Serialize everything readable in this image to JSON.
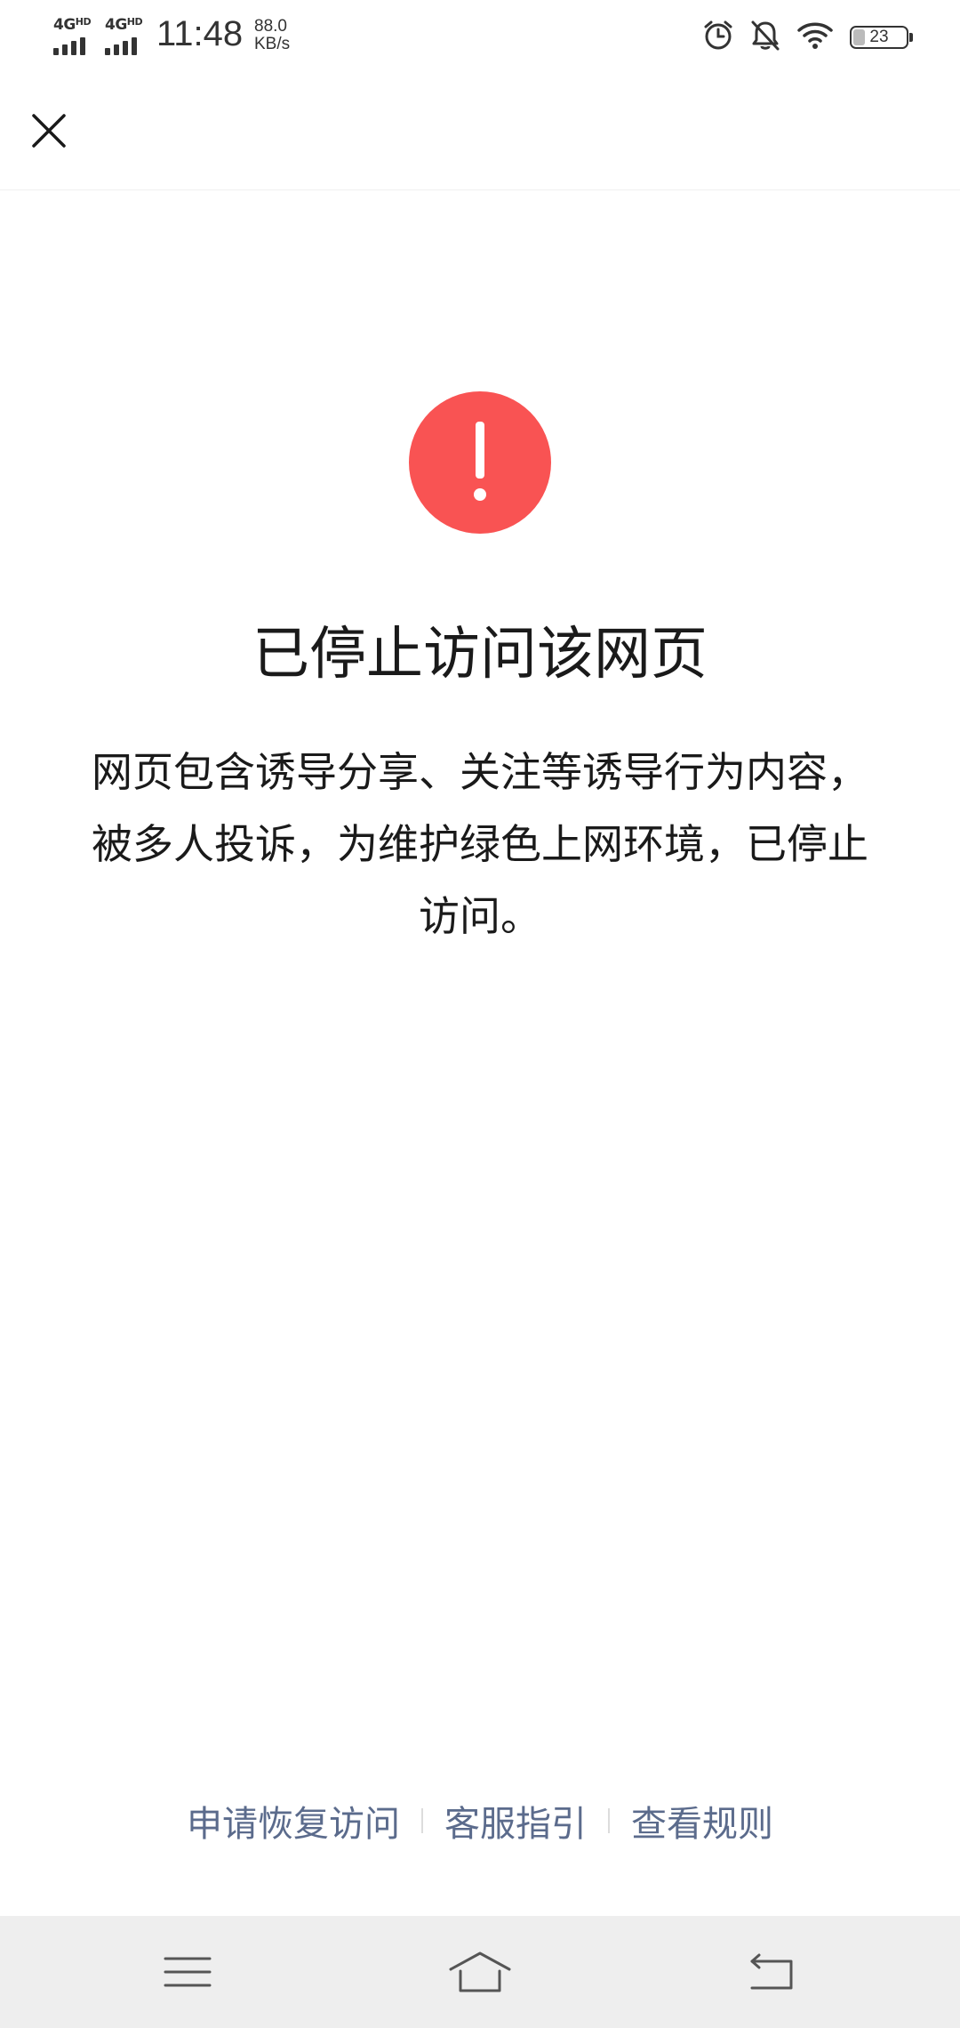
{
  "status_bar": {
    "sim1_label": "4G",
    "sim1_sup": "HD",
    "sim2_label": "4G",
    "sim2_sup": "HD",
    "time": "11:48",
    "speed_value": "88.0",
    "speed_unit": "KB/s",
    "battery_level": "23",
    "battery_fraction": 0.23,
    "icons": [
      "alarm-icon",
      "bell-muted-icon",
      "wifi-icon",
      "battery-icon"
    ]
  },
  "nav": {
    "close_icon": "close-icon"
  },
  "notice": {
    "icon": "exclamation-icon",
    "icon_color": "#f95353",
    "title": "已停止访问该网页",
    "message": "网页包含诱导分享、关注等诱导行为内容，被多人投诉，为维护绿色上网环境，已停止访问。"
  },
  "footer": {
    "link_color": "#5b6b8c",
    "links": [
      {
        "label": "申请恢复访问"
      },
      {
        "label": "客服指引"
      },
      {
        "label": "查看规则"
      }
    ]
  },
  "system_nav": {
    "icons": [
      "menu-icon",
      "home-icon",
      "back-icon"
    ]
  }
}
